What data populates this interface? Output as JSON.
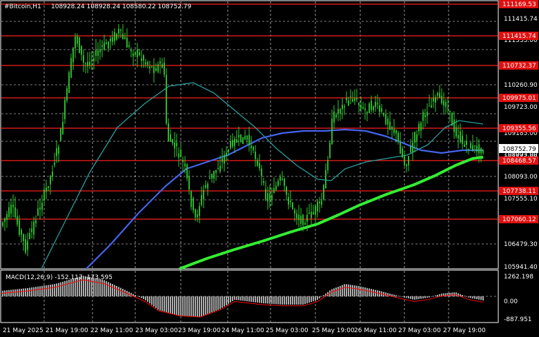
{
  "header": {
    "symbol": "#Bitcoin,H1",
    "ohlc": "108928.24 108928.24 108580.22 108752.79"
  },
  "price_axis": {
    "ticks": [
      "111169.53",
      "111415.74",
      "111335.00",
      "110732.37",
      "110260.90",
      "109975.01",
      "109723.00",
      "109185.00",
      "108903.00",
      "108093.00",
      "107555.10",
      "107738.11",
      "107060.12",
      "106479.30",
      "105941.40"
    ],
    "current_price": "108752.79",
    "current_price_small": "108547.00"
  },
  "levels": {
    "values": [
      "111169.53",
      "111415.74",
      "110732.37",
      "109975.01",
      "109355.56",
      "108468.57",
      "107738.11",
      "107060.12"
    ],
    "color": "#ff2020"
  },
  "macd": {
    "label": "MACD(12,26,9) -152.117 -173.595",
    "ticks": [
      "1262.198",
      "0.00",
      "-887.951"
    ]
  },
  "time_axis": {
    "labels": [
      "21 May 2025",
      "21 May 19:00",
      "22 May 11:00",
      "23 May 03:00",
      "23 May 19:00",
      "24 May 11:00",
      "25 May 03:00",
      "25 May 19:00",
      "26 May 11:00",
      "27 May 03:00",
      "27 May 19:00"
    ]
  },
  "colors": {
    "background": "#000000",
    "grid": "#ffffff",
    "candles": "#33cc33",
    "ma_fast": "#4466ee",
    "ma_mid": "#2aa0a0",
    "ma_slow": "#33ee33",
    "level_lines": "#ff2020",
    "macd_hist": "#c0c0c0",
    "macd_signal": "#ff0000"
  }
}
